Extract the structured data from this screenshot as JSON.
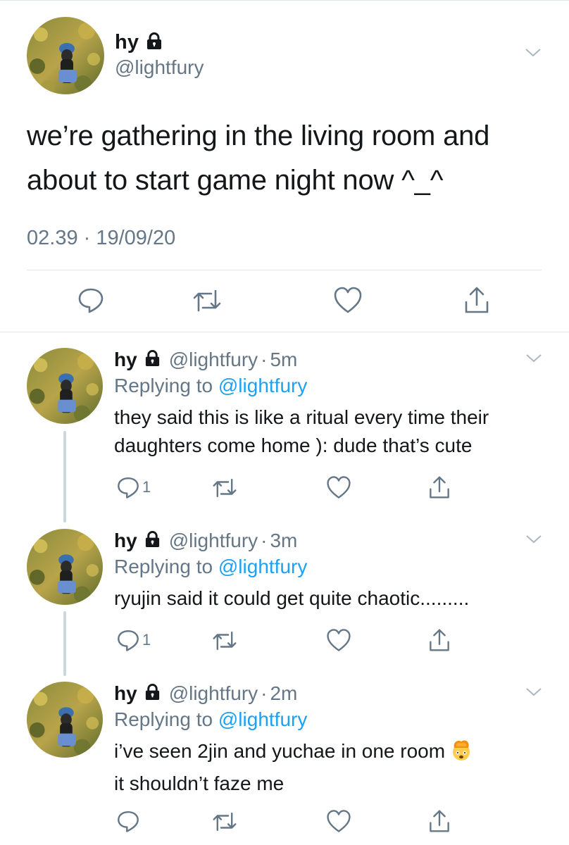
{
  "main_tweet": {
    "name": "hy",
    "handle": "@lightfury",
    "text": "we’re gathering in the living room and about to start game night now ^_^",
    "timestamp": "02.39 · 19/09/20",
    "icons": [
      "lock-icon",
      "chevron-down-icon",
      "reply-icon",
      "retweet-icon",
      "like-icon",
      "share-icon"
    ]
  },
  "replies": [
    {
      "name": "hy",
      "handle": "@lightfury",
      "separator": "·",
      "time": "5m",
      "replying_prefix": "Replying to",
      "replying_to": "@lightfury",
      "text": "they said this is like a ritual every time their daughters come home ): dude that’s cute",
      "reply_count": "1"
    },
    {
      "name": "hy",
      "handle": "@lightfury",
      "separator": "·",
      "time": "3m",
      "replying_prefix": "Replying to",
      "replying_to": "@lightfury",
      "text": "ryujin said it could get quite chaotic.........",
      "reply_count": "1"
    },
    {
      "name": "hy",
      "handle": "@lightfury",
      "separator": "·",
      "time": "2m",
      "replying_prefix": "Replying to",
      "replying_to": "@lightfury",
      "text_line1": "i’ve seen 2jin and yuchae in one room",
      "emoji": "exploding-head-emoji",
      "text_line2": "it shouldn’t faze me",
      "reply_count": ""
    }
  ],
  "colors": {
    "text": "#14171a",
    "secondary": "#657786",
    "link": "#1da1f2",
    "divider": "#e1e8ed",
    "thread_line": "#ccd6dd"
  }
}
